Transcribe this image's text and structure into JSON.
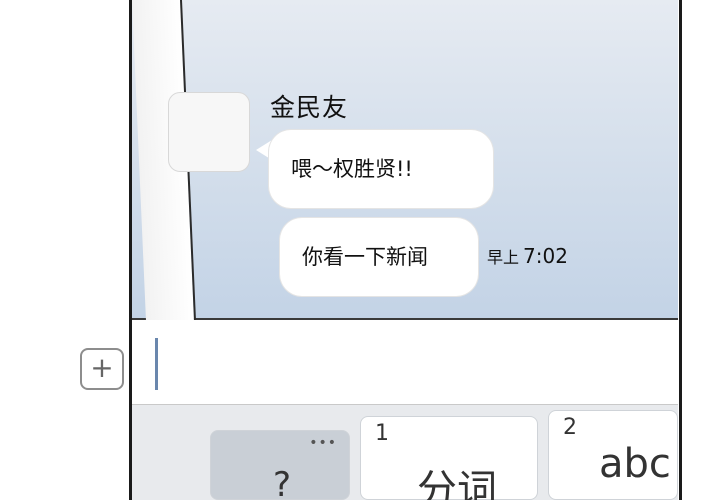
{
  "chat": {
    "sender_name": "金民友",
    "messages": [
      {
        "text": "喂～权胜贤!!"
      },
      {
        "text": "你看一下新闻"
      }
    ],
    "time_period": "早上",
    "time": "7:02"
  },
  "input": {
    "plus_icon": "plus-icon",
    "value": ""
  },
  "keyboard": {
    "symbol_key_label": "?",
    "key1_number": "1",
    "key1_label": "分词",
    "key2_number": "2",
    "key2_label": "abc",
    "symbol_key_more": "•••"
  },
  "colors": {
    "chat_bg_top": "#e6ebf2",
    "chat_bg_bottom": "#c3d3e6",
    "cursor": "#6a87ad"
  }
}
